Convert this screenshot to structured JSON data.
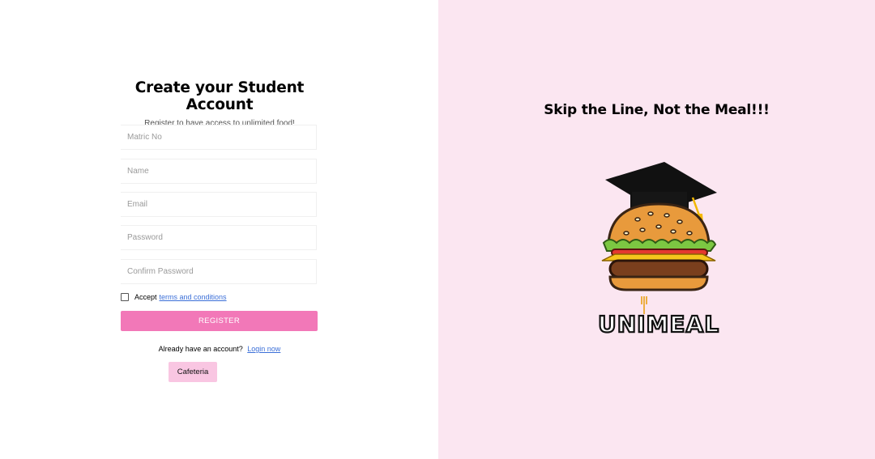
{
  "register_panel": {
    "title": "Create your Student Account",
    "subtitle": "Register to have access to unlimited food!",
    "fields": [
      {
        "placeholder": "Matric No",
        "value": ""
      },
      {
        "placeholder": "Name",
        "value": ""
      },
      {
        "placeholder": "Email",
        "value": ""
      },
      {
        "placeholder": "Password",
        "value": ""
      },
      {
        "placeholder": "Confirm Password",
        "value": ""
      }
    ],
    "terms": {
      "prefix": "Accept",
      "link": "terms and conditions",
      "checked": false
    },
    "register_label": "REGISTER",
    "login_prompt": {
      "text": "Already have an account?",
      "link": "Login now"
    },
    "cafeteria_label": "Cafeteria"
  },
  "promo_panel": {
    "tagline": "Skip the Line, Not the Meal!!!",
    "logo_text": "UNIMEAL"
  },
  "colors": {
    "accent": "#f278b8",
    "promo_background": "#fbe6f1",
    "cafeteria_button": "#f9c6e2",
    "link": "#3b6fd8"
  }
}
